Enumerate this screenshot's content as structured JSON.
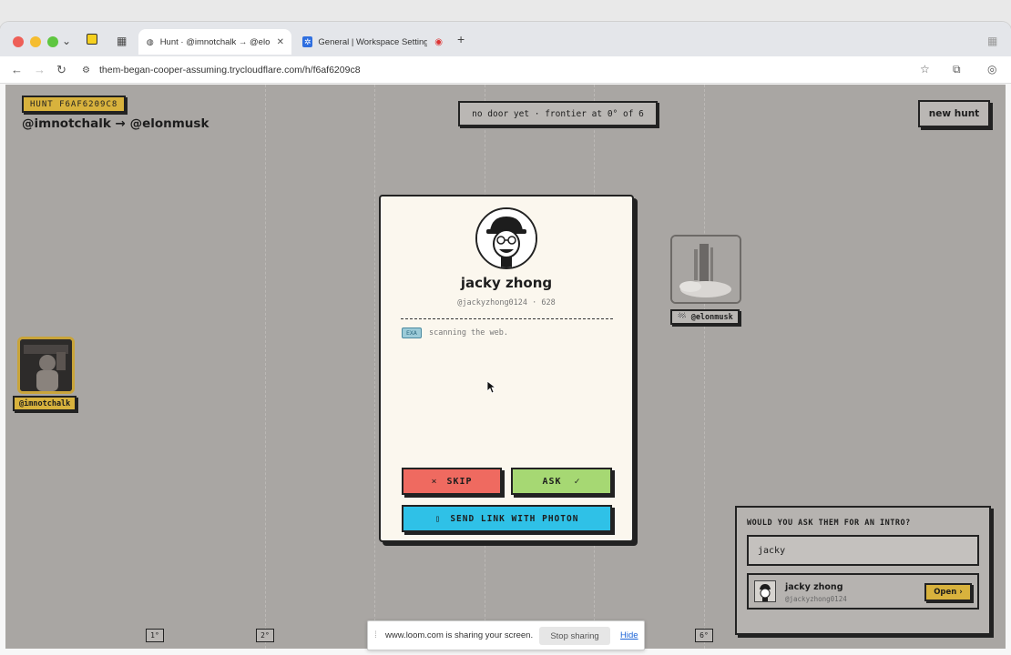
{
  "browser": {
    "tabs": [
      {
        "label": "Hunt · @imnotchalk → @elonmusk",
        "active": true
      },
      {
        "label": "General | Workspace Settings",
        "active": false
      }
    ],
    "url": "them-began-cooper-assuming.trycloudflare.com/h/f6af6209c8"
  },
  "header": {
    "hunt_badge": "HUNT F6AF6209C8",
    "title": "@imnotchalk → @elonmusk",
    "status": "no door yet · frontier at 0° of 6",
    "new_hunt_label": "new hunt"
  },
  "nodes": {
    "source_label": "@imnotchalk",
    "target_label": "🏁 @elonmusk"
  },
  "card": {
    "name": "jacky zhong",
    "handle": "@jackyzhong0124 · 628",
    "exa_tag": "EXA",
    "scan_text": "scanning the web.",
    "skip_label": "SKIP",
    "skip_symbol": "×",
    "ask_label": "ASK",
    "ask_symbol": "✓",
    "photon_symbol": "▯",
    "photon_label": "SEND LINK WITH PHOTON"
  },
  "intro": {
    "question": "WOULD YOU ASK THEM FOR AN INTRO?",
    "input_value": "jacky",
    "result_name": "jacky zhong",
    "result_handle": "@jackyzhong0124",
    "open_label": "Open ›"
  },
  "degrees": [
    "1°",
    "2°",
    "6°"
  ],
  "loom": {
    "message": "www.loom.com is sharing your screen.",
    "stop_label": "Stop sharing",
    "hide_label": "Hide"
  },
  "colors": {
    "page_bg": "#a9a6a3",
    "card_bg": "#fbf7ee",
    "badge_gold": "#d8b23d",
    "skip_red": "#ef6a60",
    "ask_green": "#a6d873",
    "photon_blue": "#2fc1e7"
  }
}
